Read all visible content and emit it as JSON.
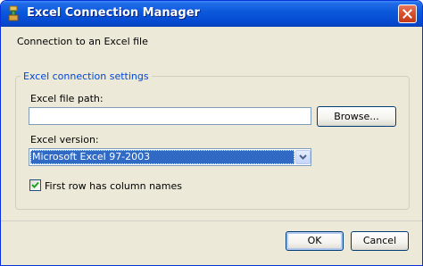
{
  "window": {
    "title": "Excel Connection Manager",
    "title_icon": "excel-connection-icon",
    "close_icon": "close-icon"
  },
  "description": "Connection to an Excel file",
  "group": {
    "legend": "Excel connection settings",
    "file_path_label": "Excel file path:",
    "file_path_value": "",
    "browse_label": "Browse...",
    "version_label": "Excel version:",
    "version_selected": "Microsoft Excel 97-2003",
    "first_row_label": "First row has column names",
    "first_row_checked": true
  },
  "buttons": {
    "ok": "OK",
    "cancel": "Cancel"
  },
  "colors": {
    "titlebar": "#0a58da",
    "selection": "#316ac5",
    "legend_text": "#0046d5",
    "checkmark": "#21a121"
  }
}
